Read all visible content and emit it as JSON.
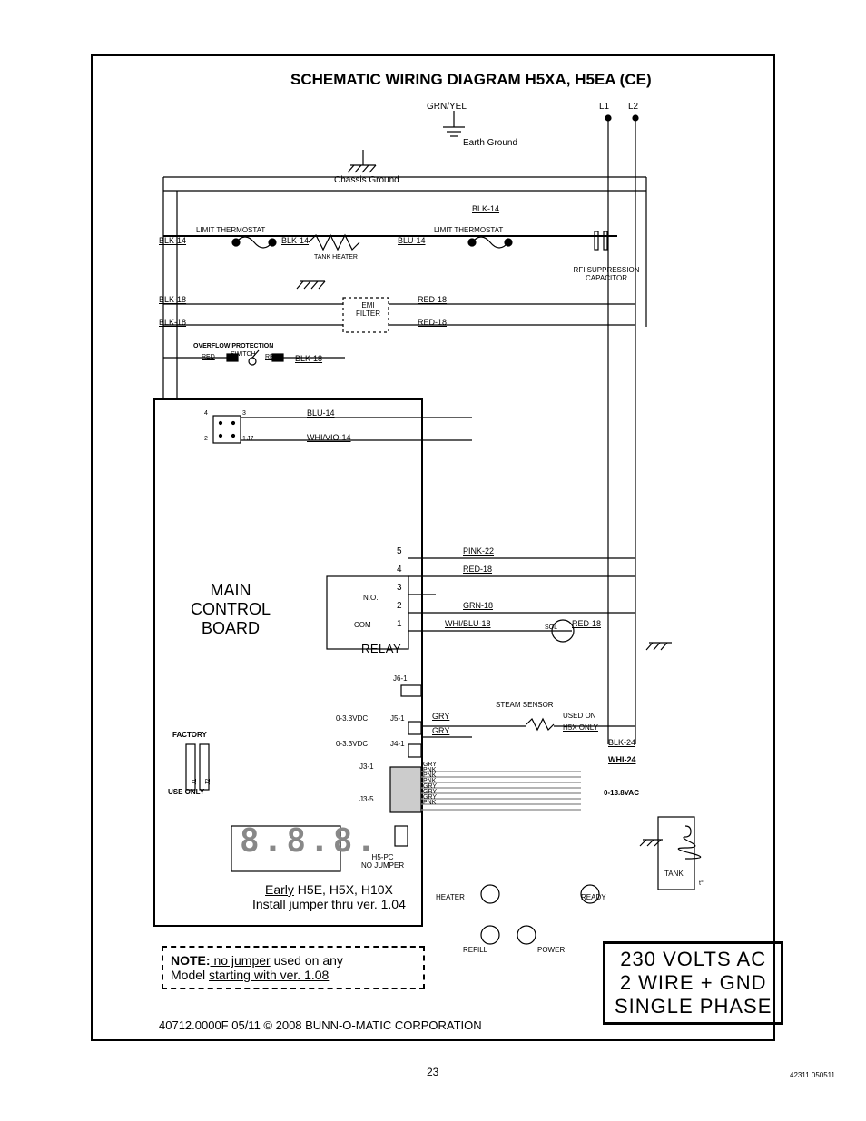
{
  "title": "SCHEMATIC WIRING DIAGRAM H5XA, H5EA (CE)",
  "ground": {
    "grn_yel": "GRN/YEL",
    "earth": "Earth Ground",
    "chassis": "Chassis Ground"
  },
  "lines": {
    "l1": "L1",
    "l2": "L2"
  },
  "thermostat": {
    "limit1": "LIMIT THERMOSTAT",
    "limit2": "LIMIT THERMOSTAT"
  },
  "tank_heater": "TANK HEATER",
  "rfi": {
    "label": "RFI SUPPRESSION",
    "label2": "CAPACITOR"
  },
  "emi": {
    "line1": "EMI",
    "line2": "FILTER"
  },
  "overflow": {
    "title": "OVERFLOW PROTECTION",
    "switch": "SWITCH",
    "red1": "RED",
    "red2": "RED"
  },
  "wires": {
    "blk14a": "BLK-14",
    "blk14b": "BLK-14",
    "blk14c": "BLK-14",
    "blu14a": "BLU-14",
    "blu14b": "BLU-14",
    "blk18a": "BLK-18",
    "blk18b": "BLK-18",
    "blk18c": "BLK-18",
    "red18a": "RED-18",
    "red18b": "RED-18",
    "red18c": "RED-18",
    "red18d": "RED-18",
    "whi_vio14": "WHI/VIO-14",
    "pink22": "PINK-22",
    "grn18": "GRN-18",
    "whi_blu18": "WHI/BLU-18",
    "blk24": "BLK-24",
    "whi24": "WHI-24",
    "gry1": "GRY",
    "gry2": "GRY",
    "j3_gry": "GRY",
    "j3_pnk": "PNK"
  },
  "main_board": {
    "line1": "MAIN",
    "line2": "CONTROL",
    "line3": "BOARD"
  },
  "relay": {
    "label": "RELAY",
    "p1": "1",
    "p2": "2",
    "p3": "3",
    "p4": "4",
    "p5": "5",
    "no": "N.O.",
    "com": "COM"
  },
  "jacks": {
    "j7": "J7",
    "j7_1": "1",
    "j7_2": "2",
    "j7_3": "3",
    "j7_4": "4",
    "j6": "J6-1",
    "j5": "J5-1",
    "j5v": "0-3.3VDC",
    "j4": "J4-1",
    "j4v": "0-3.3VDC",
    "j3a": "J3-1",
    "j3b": "J3-5"
  },
  "factory": {
    "line1": "FACTORY",
    "line2": "USE ONLY",
    "j1": "J1",
    "j2": "J2"
  },
  "h5pc": {
    "line1": "H5-PC",
    "line2": "NO JUMPER"
  },
  "steam": {
    "label": "STEAM SENSOR",
    "used": "USED ON",
    "only": "H5X ONLY"
  },
  "tank": {
    "label": "TANK",
    "volt": "0-13.8VAC",
    "temp": "t°"
  },
  "sol": "SOL",
  "indicators": {
    "heater": "HEATER",
    "ready": "READY",
    "refill": "REFILL",
    "power": "POWER"
  },
  "jumper_note": {
    "line1a": "Early",
    "line1b": " H5E, H5X, H10X",
    "line2a": "Install jumper ",
    "line2b": "thru ver. 1.04"
  },
  "note": {
    "prefix": "NOTE:",
    "mid": " no jumper",
    "rest": " used on any",
    "line2a": "Model ",
    "line2b": "starting with ver. 1.08"
  },
  "voltage": {
    "line1": "230 VOLTS AC",
    "line2": "2 WIRE + GND",
    "line3": "SINGLE PHASE"
  },
  "footer": {
    "text": "40712.0000F  05/11  ©  2008 BUNN-O-MATIC CORPORATION"
  },
  "page_number": "23",
  "doc_number": "42311 050511"
}
